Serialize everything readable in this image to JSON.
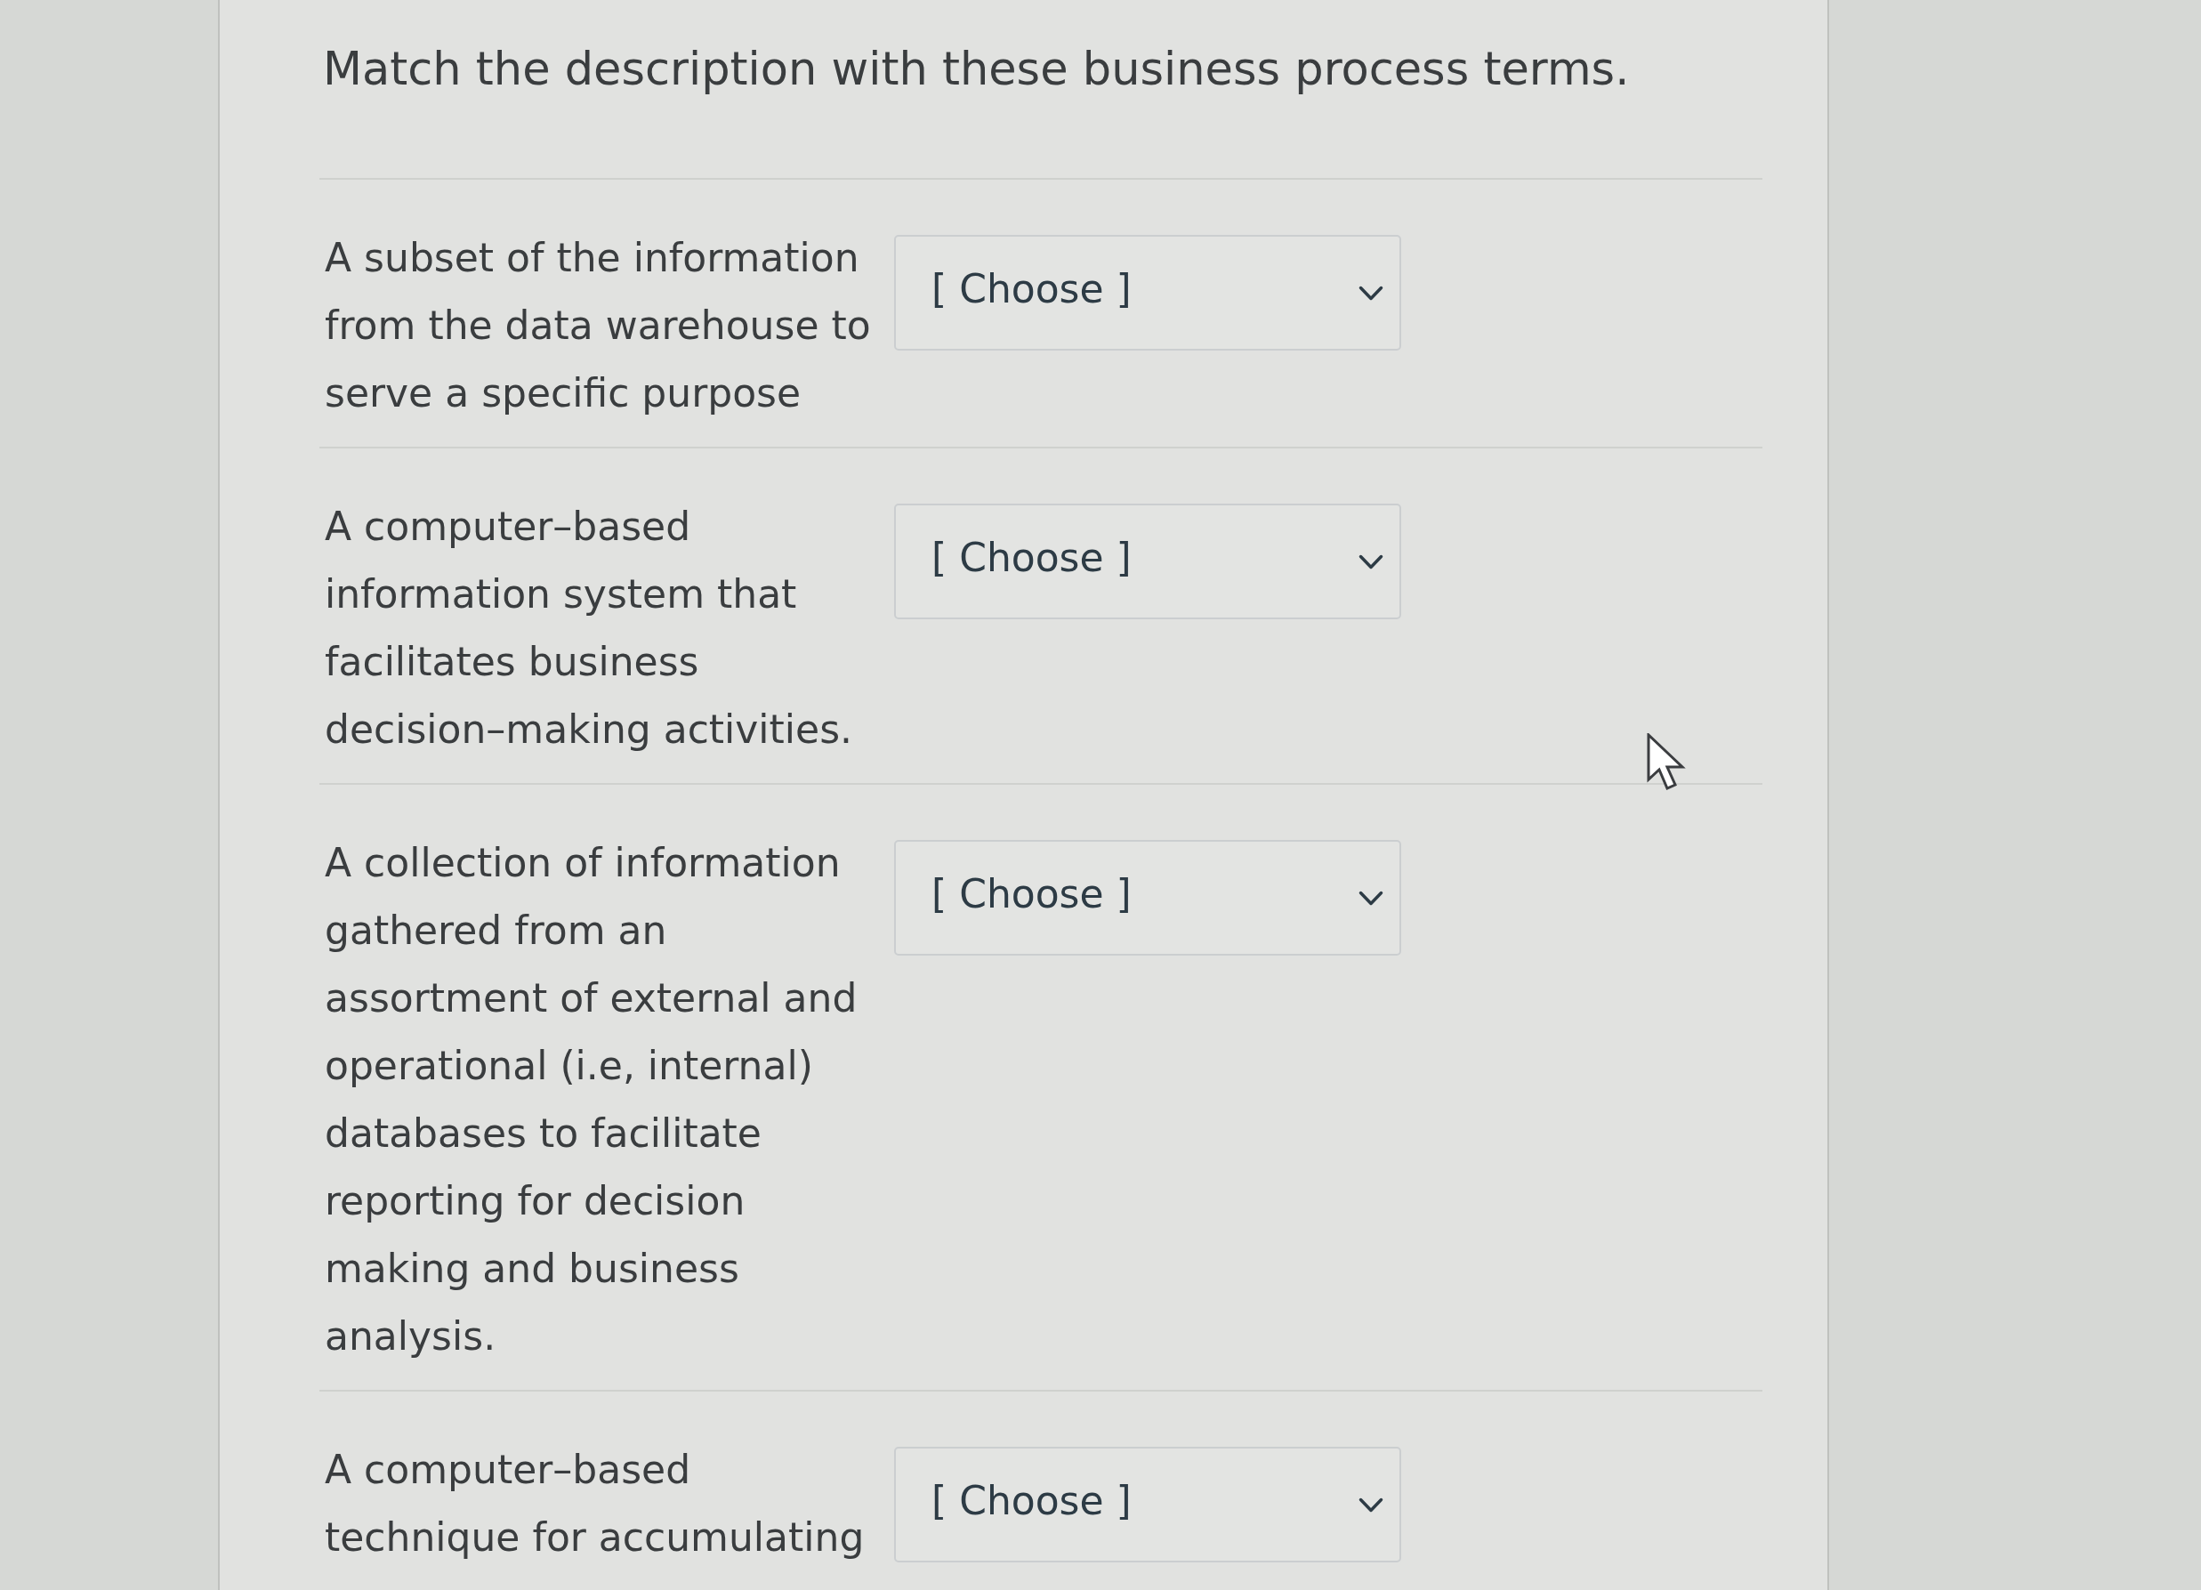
{
  "title": "Match the description with these business process terms.",
  "items": [
    {
      "prompt": "A subset of the information from the data warehouse to serve a specific purpose",
      "dropdown": {
        "value": "[ Choose ]"
      }
    },
    {
      "prompt": "A computer–based information system that facilitates business decision–making activities.",
      "dropdown": {
        "value": "[ Choose ]"
      }
    },
    {
      "prompt": "A collection of information gathered from an assortment of external and operational (i.e, internal) databases to facilitate reporting for decision making and business analysis.",
      "dropdown": {
        "value": "[ Choose ]"
      }
    },
    {
      "prompt": "A computer–based technique for accumulating",
      "dropdown": {
        "value": "[ Choose ]"
      }
    }
  ]
}
